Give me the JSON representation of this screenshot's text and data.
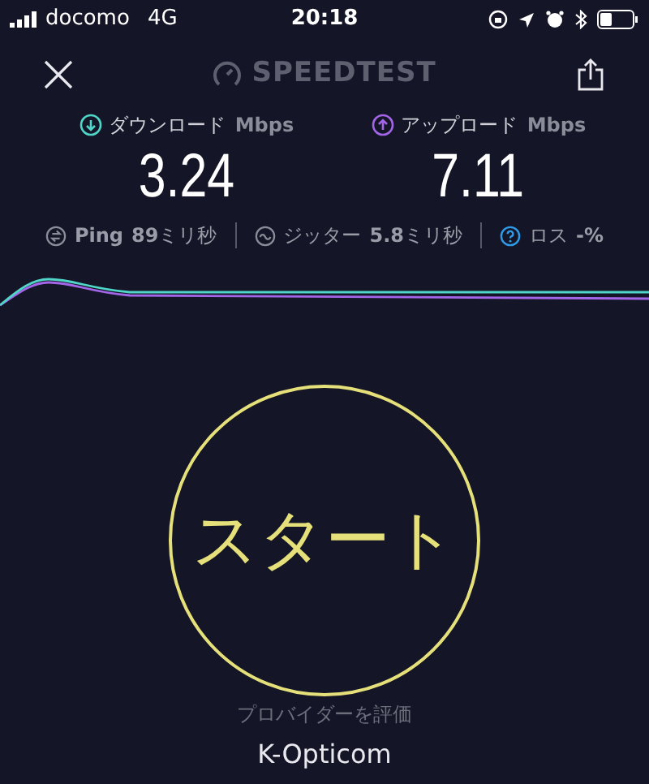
{
  "status_bar": {
    "carrier": "docomo",
    "network": "4G",
    "time": "20:18"
  },
  "header": {
    "title": "SPEEDTEST"
  },
  "results": [
    {
      "kind": "download",
      "label": "ダウンロード",
      "unit": "Mbps",
      "value": "3.24",
      "color": "#4fd6c8"
    },
    {
      "kind": "upload",
      "label": "アップロード",
      "unit": "Mbps",
      "value": "7.11",
      "color": "#a466e8"
    }
  ],
  "stats": [
    {
      "kind": "ping",
      "label": "Ping",
      "value": "**89**ミリ秒"
    },
    {
      "kind": "jitter",
      "label": "ジッター",
      "value": "**5.8**ミリ秒"
    },
    {
      "kind": "loss",
      "label": "ロス",
      "value": "**-%**"
    }
  ],
  "start_button": {
    "label": "スタート"
  },
  "provider": {
    "caption": "プロバイダーを評価",
    "name": "K-Opticom"
  }
}
